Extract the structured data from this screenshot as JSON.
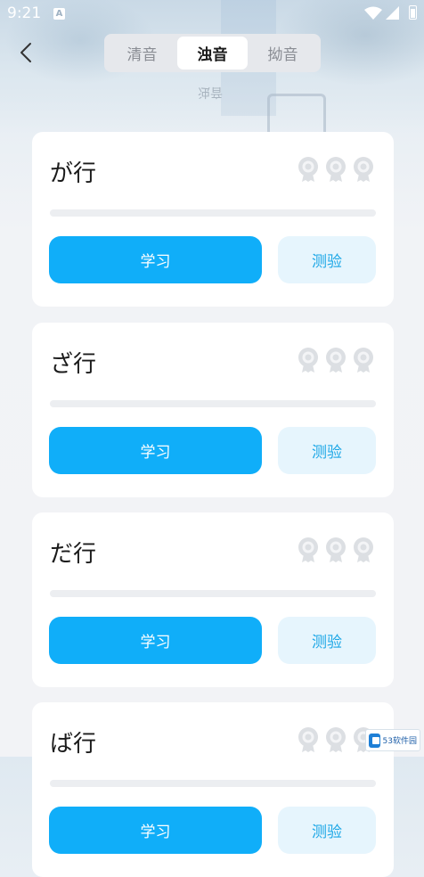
{
  "status_bar": {
    "time": "9:21",
    "notification_glyph": "A",
    "icons": [
      "wifi-icon",
      "signal-icon",
      "battery-icon"
    ]
  },
  "header": {
    "back_icon": "chevron-left-icon",
    "tabs": [
      {
        "label": "清音",
        "active": false
      },
      {
        "label": "浊音",
        "active": true
      },
      {
        "label": "拗音",
        "active": false
      }
    ],
    "mirrored_label": "浊音"
  },
  "cards": [
    {
      "title": "が行",
      "medals": 3,
      "progress": 0,
      "study_label": "学习",
      "quiz_label": "测验"
    },
    {
      "title": "ざ行",
      "medals": 3,
      "progress": 0,
      "study_label": "学习",
      "quiz_label": "测验"
    },
    {
      "title": "だ行",
      "medals": 3,
      "progress": 0,
      "study_label": "学习",
      "quiz_label": "测验"
    },
    {
      "title": "ば行",
      "medals": 3,
      "progress": 0,
      "study_label": "学习",
      "quiz_label": "测验"
    }
  ],
  "watermark": {
    "text": "53软件园"
  },
  "colors": {
    "accent": "#10aef9",
    "quiz_bg": "#e6f5fd",
    "quiz_text": "#1aa6e6",
    "medal": "#dcdfe3"
  }
}
